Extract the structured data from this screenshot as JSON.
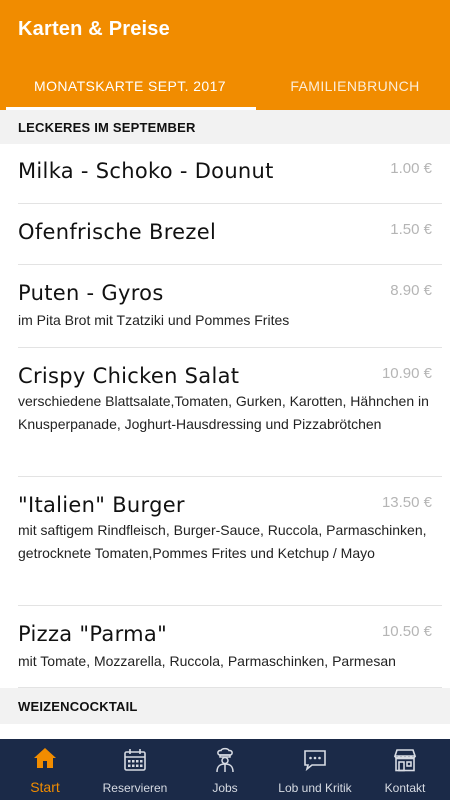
{
  "header": {
    "title": "Karten & Preise",
    "background": "#f18c00"
  },
  "tabs": [
    {
      "label": "MONATSKARTE SEPT. 2017",
      "selected": true
    },
    {
      "label": "FAMILIENBRUNCH",
      "selected": false
    }
  ],
  "sections": [
    {
      "title": "LECKERES IM SEPTEMBER",
      "items": [
        {
          "name": "Milka - Schoko - Dounut",
          "price": "1.00 €",
          "description": ""
        },
        {
          "name": "Ofenfrische Brezel",
          "price": "1.50 €",
          "description": ""
        },
        {
          "name": "Puten - Gyros",
          "price": "8.90 €",
          "description": "im Pita Brot mit Tzatziki und Pommes Frites"
        },
        {
          "name": "Crispy Chicken Salat",
          "price": "10.90 €",
          "description": "verschiedene Blattsalate,Tomaten, Gurken, Karotten, Hähnchen in Knusperpanade, Joghurt-Hausdressing und Pizzabrötchen"
        },
        {
          "name": "\"Italien\" Burger",
          "price": "13.50 €",
          "description": "mit saftigem Rindfleisch, Burger-Sauce, Ruccola, Parmaschinken, getrocknete Tomaten,Pommes Frites und Ketchup / Mayo"
        },
        {
          "name": "Pizza \"Parma\"",
          "price": "10.50 €",
          "description": "mit Tomate, Mozzarella, Ruccola, Parmaschinken, Parmesan"
        }
      ]
    },
    {
      "title": "WEIZENCOCKTAIL",
      "items": []
    }
  ],
  "bottom_nav": {
    "background": "#1b2a48",
    "active_color": "#f18c00",
    "items": [
      {
        "label": "Start",
        "icon": "home-icon",
        "active": true
      },
      {
        "label": "Reservieren",
        "icon": "calendar-icon",
        "active": false
      },
      {
        "label": "Jobs",
        "icon": "chef-icon",
        "active": false
      },
      {
        "label": "Lob und Kritik",
        "icon": "chat-bubble-icon",
        "active": false
      },
      {
        "label": "Kontakt",
        "icon": "storefront-icon",
        "active": false
      }
    ]
  }
}
